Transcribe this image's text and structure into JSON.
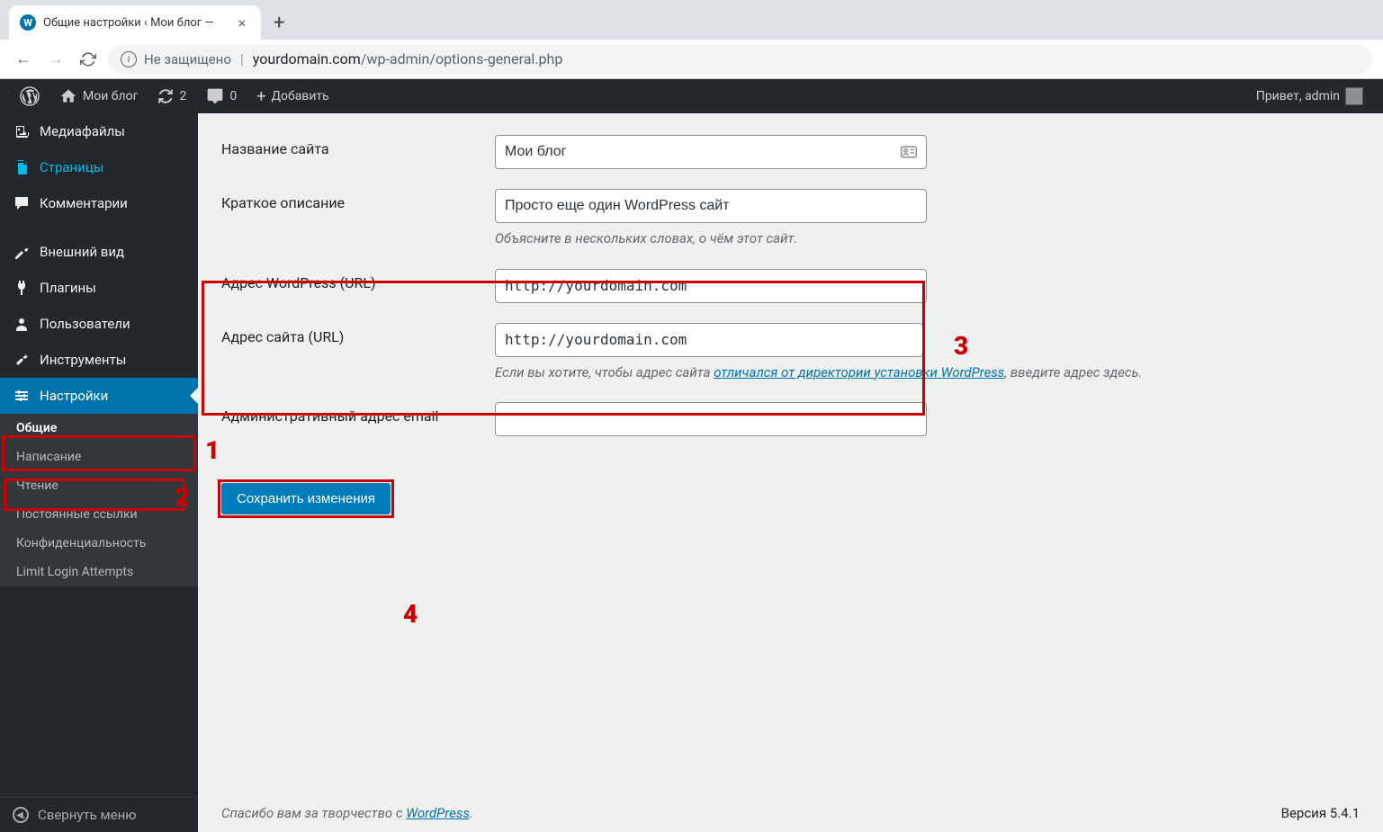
{
  "browser": {
    "tab_title": "Общие настройки ‹ Мои блог —",
    "security_warning": "Не защищено",
    "url_domain": "yourdomain.com",
    "url_path": "/wp-admin/options-general.php"
  },
  "adminbar": {
    "site_name": "Мои блог",
    "updates_count": "2",
    "comments_count": "0",
    "add_new": "Добавить",
    "greeting": "Привет, admin"
  },
  "sidebar": {
    "items": [
      {
        "label": "Медиафайлы",
        "icon": "media"
      },
      {
        "label": "Страницы",
        "icon": "pages"
      },
      {
        "label": "Комментарии",
        "icon": "comments"
      },
      {
        "label": "Внешний вид",
        "icon": "appearance"
      },
      {
        "label": "Плагины",
        "icon": "plugins"
      },
      {
        "label": "Пользователи",
        "icon": "users"
      },
      {
        "label": "Инструменты",
        "icon": "tools"
      },
      {
        "label": "Настройки",
        "icon": "settings"
      }
    ],
    "submenus": {
      "settings": [
        "Общие",
        "Написание",
        "Чтение",
        "Постоянные ссылки",
        "Конфиденциальность",
        "Limit Login Attempts"
      ]
    },
    "collapse_label": "Свернуть меню"
  },
  "form": {
    "site_title": {
      "label": "Название сайта",
      "value": "Мои блог"
    },
    "tagline": {
      "label": "Краткое описание",
      "value": "Просто еще один WordPress сайт",
      "desc": "Объясните в нескольких словах, о чём этот сайт."
    },
    "wp_url": {
      "label": "Адрес WordPress (URL)",
      "value": "http://yourdomain.com"
    },
    "site_url": {
      "label": "Адрес сайта (URL)",
      "value": "http://yourdomain.com",
      "desc_pre": "Если вы хотите, чтобы адрес сайта ",
      "desc_link": "отличался от директории установки WordPress",
      "desc_post": ", введите адрес здесь."
    },
    "admin_email": {
      "label": "Административный адрес email",
      "value": ""
    },
    "submit": "Сохранить изменения"
  },
  "footer": {
    "thanks_pre": "Спасибо вам за творчество с ",
    "thanks_link": "WordPress",
    "version": "Версия 5.4.1"
  },
  "annotations": {
    "n1": "1",
    "n2": "2",
    "n3": "3",
    "n4": "4"
  }
}
